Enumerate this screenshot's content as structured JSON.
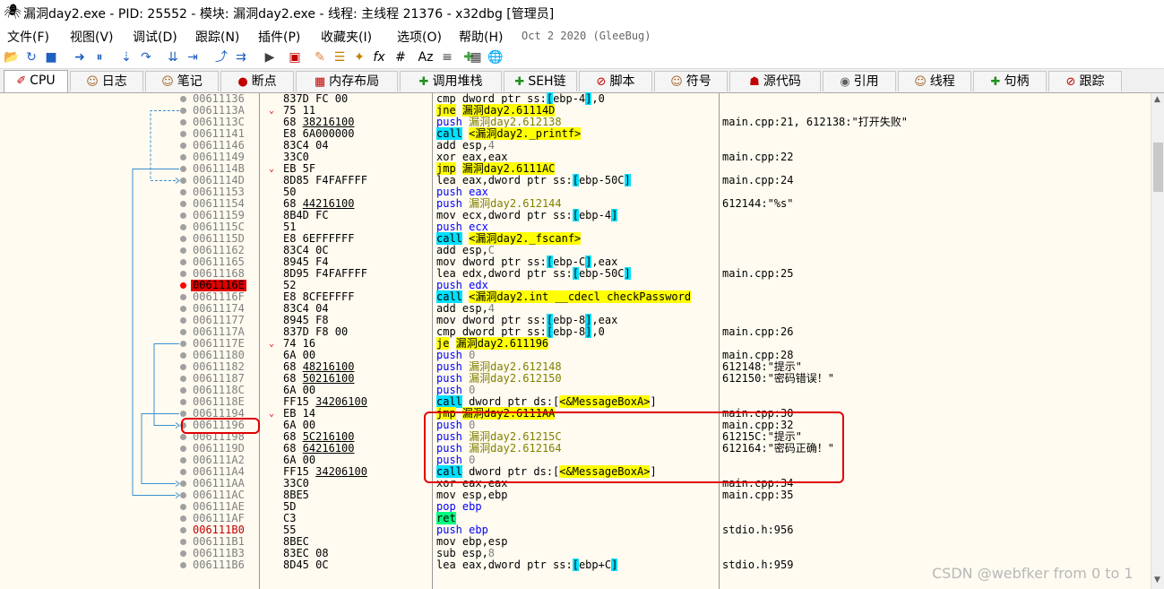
{
  "window": {
    "title": "漏洞day2.exe - PID: 25552 - 模块: 漏洞day2.exe - 线程: 主线程 21376 - x32dbg [管理员]"
  },
  "menu": {
    "items": [
      "文件(F)",
      "视图(V)",
      "调试(D)",
      "跟踪(N)",
      "插件(P)",
      "收藏夹(I)",
      "选项(O)",
      "帮助(H)"
    ],
    "build_date": "Oct 2 2020 (GleeBug)"
  },
  "toolbar": {
    "icons": [
      "open-icon",
      "restart-icon",
      "stop-icon",
      "run-icon",
      "pause-icon",
      "step-into-icon",
      "step-over-icon",
      "trace-into-icon",
      "trace-over-icon",
      "execute-till-return-icon",
      "run-to-user-code-icon",
      "animate-icon",
      "script-icon",
      "comment-icon",
      "label-icon",
      "bookmark-icon",
      "function-icon",
      "hash-icon",
      "font-icon",
      "strings-icon",
      "patch-icon",
      "calculator-icon",
      "help-icon"
    ],
    "fx_label": "fx",
    "hash_label": "#",
    "font_label": "Az"
  },
  "tabs": [
    {
      "label": "CPU",
      "icon": "cpu-icon"
    },
    {
      "label": "日志",
      "icon": "log-icon"
    },
    {
      "label": "笔记",
      "icon": "notes-icon"
    },
    {
      "label": "断点",
      "icon": "breakpoint-icon"
    },
    {
      "label": "内存布局",
      "icon": "memory-icon"
    },
    {
      "label": "调用堆栈",
      "icon": "callstack-icon"
    },
    {
      "label": "SEH链",
      "icon": "seh-icon"
    },
    {
      "label": "脚本",
      "icon": "script-icon"
    },
    {
      "label": "符号",
      "icon": "symbols-icon"
    },
    {
      "label": "源代码",
      "icon": "source-icon"
    },
    {
      "label": "引用",
      "icon": "references-icon"
    },
    {
      "label": "线程",
      "icon": "threads-icon"
    },
    {
      "label": "句柄",
      "icon": "handles-icon"
    },
    {
      "label": "跟踪",
      "icon": "trace-icon"
    }
  ],
  "disasm": [
    {
      "addr": "00611136",
      "bytes": "837D FC 00",
      "instr": [
        [
          "cmp dword ptr ss:",
          ""
        ],
        [
          "[",
          "seg"
        ],
        [
          "ebp-4",
          ""
        ],
        [
          "]",
          "seg"
        ],
        [
          ",0",
          ""
        ]
      ],
      "cmt": ""
    },
    {
      "addr": "0061113A",
      "mark": "v",
      "bytes": "75 11",
      "instr": [
        [
          "jne",
          "jmp"
        ],
        [
          " ",
          ""
        ],
        [
          "漏洞day2.61114D",
          "tgt"
        ]
      ],
      "cmt": ""
    },
    {
      "addr": "0061113C",
      "bytes": "68 38216100",
      "ul": "38216100",
      "instr": [
        [
          "push",
          "push"
        ],
        [
          " ",
          ""
        ],
        [
          "漏洞day2.612138",
          "str"
        ]
      ],
      "cmt": "main.cpp:21, 612138:\"打开失败\""
    },
    {
      "addr": "00611141",
      "bytes": "E8 6A000000",
      "instr": [
        [
          "call",
          "call"
        ],
        [
          " ",
          ""
        ],
        [
          "<漏洞day2._printf>",
          "tgt"
        ]
      ],
      "cmt": ""
    },
    {
      "addr": "00611146",
      "bytes": "83C4 04",
      "instr": [
        [
          "add esp,",
          ""
        ],
        [
          "4",
          "num"
        ]
      ],
      "cmt": ""
    },
    {
      "addr": "00611149",
      "bytes": "33C0",
      "instr": [
        [
          "xor eax,eax",
          ""
        ]
      ],
      "cmt": "main.cpp:22"
    },
    {
      "addr": "0061114B",
      "mark": "v",
      "bytes": "EB 5F",
      "instr": [
        [
          "jmp",
          "jmp"
        ],
        [
          " ",
          ""
        ],
        [
          "漏洞day2.6111AC",
          "tgt"
        ]
      ],
      "cmt": ""
    },
    {
      "addr": "0061114D",
      "bytes": "8D85 F4FAFFFF",
      "instr": [
        [
          "lea eax,dword ptr ss:",
          ""
        ],
        [
          "[",
          "seg"
        ],
        [
          "ebp-50C",
          ""
        ],
        [
          "]",
          "seg"
        ]
      ],
      "cmt": "main.cpp:24"
    },
    {
      "addr": "00611153",
      "bytes": "50",
      "instr": [
        [
          "push eax",
          "push"
        ]
      ],
      "cmt": ""
    },
    {
      "addr": "00611154",
      "bytes": "68 44216100",
      "ul": "44216100",
      "instr": [
        [
          "push",
          "push"
        ],
        [
          " ",
          ""
        ],
        [
          "漏洞day2.612144",
          "str"
        ]
      ],
      "cmt": "612144:\"%s\""
    },
    {
      "addr": "00611159",
      "bytes": "8B4D FC",
      "instr": [
        [
          "mov ecx,dword ptr ss:",
          ""
        ],
        [
          "[",
          "seg"
        ],
        [
          "ebp-4",
          ""
        ],
        [
          "]",
          "seg"
        ]
      ],
      "cmt": ""
    },
    {
      "addr": "0061115C",
      "bytes": "51",
      "instr": [
        [
          "push ecx",
          "push"
        ]
      ],
      "cmt": ""
    },
    {
      "addr": "0061115D",
      "bytes": "E8 6EFFFFFF",
      "instr": [
        [
          "call",
          "call"
        ],
        [
          " ",
          ""
        ],
        [
          "<漏洞day2._fscanf>",
          "tgt"
        ]
      ],
      "cmt": ""
    },
    {
      "addr": "00611162",
      "bytes": "83C4 0C",
      "instr": [
        [
          "add esp,",
          ""
        ],
        [
          "C",
          "num"
        ]
      ],
      "cmt": ""
    },
    {
      "addr": "00611165",
      "bytes": "8945 F4",
      "instr": [
        [
          "mov dword ptr ss:",
          ""
        ],
        [
          "[",
          "seg"
        ],
        [
          "ebp-C",
          ""
        ],
        [
          "]",
          "seg"
        ],
        [
          ",eax",
          ""
        ]
      ],
      "cmt": ""
    },
    {
      "addr": "00611168",
      "bytes": "8D95 F4FAFFFF",
      "instr": [
        [
          "lea edx,dword ptr ss:",
          ""
        ],
        [
          "[",
          "seg"
        ],
        [
          "ebp-50C",
          ""
        ],
        [
          "]",
          "seg"
        ]
      ],
      "cmt": "main.cpp:25"
    },
    {
      "addr": "0061116E",
      "hl": true,
      "bp": "red",
      "bytes": "52",
      "instr": [
        [
          "push edx",
          "push"
        ]
      ],
      "cmt": ""
    },
    {
      "addr": "0061116F",
      "bytes": "E8 8CFEFFFF",
      "instr": [
        [
          "call",
          "call"
        ],
        [
          " ",
          ""
        ],
        [
          "<漏洞day2.int __cdecl checkPassword",
          "tgt"
        ]
      ],
      "cmt": ""
    },
    {
      "addr": "00611174",
      "bytes": "83C4 04",
      "instr": [
        [
          "add esp,",
          ""
        ],
        [
          "4",
          "num"
        ]
      ],
      "cmt": ""
    },
    {
      "addr": "00611177",
      "bytes": "8945 F8",
      "instr": [
        [
          "mov dword ptr ss:",
          ""
        ],
        [
          "[",
          "seg"
        ],
        [
          "ebp-8",
          ""
        ],
        [
          "]",
          "seg"
        ],
        [
          ",eax",
          ""
        ]
      ],
      "cmt": ""
    },
    {
      "addr": "0061117A",
      "bytes": "837D F8 00",
      "instr": [
        [
          "cmp dword ptr ss:",
          ""
        ],
        [
          "[",
          "seg"
        ],
        [
          "ebp-8",
          ""
        ],
        [
          "]",
          "seg"
        ],
        [
          ",0",
          ""
        ]
      ],
      "cmt": "main.cpp:26"
    },
    {
      "addr": "0061117E",
      "mark": "v",
      "bytes": "74 16",
      "instr": [
        [
          "je",
          "jmp"
        ],
        [
          " ",
          ""
        ],
        [
          "漏洞day2.611196",
          "tgt"
        ]
      ],
      "cmt": ""
    },
    {
      "addr": "00611180",
      "bytes": "6A 00",
      "instr": [
        [
          "push",
          "push"
        ],
        [
          " ",
          ""
        ],
        [
          "0",
          "num"
        ]
      ],
      "cmt": "main.cpp:28"
    },
    {
      "addr": "00611182",
      "bytes": "68 48216100",
      "ul": "48216100",
      "instr": [
        [
          "push",
          "push"
        ],
        [
          " ",
          ""
        ],
        [
          "漏洞day2.612148",
          "str"
        ]
      ],
      "cmt": "612148:\"提示\""
    },
    {
      "addr": "00611187",
      "bytes": "68 50216100",
      "ul": "50216100",
      "instr": [
        [
          "push",
          "push"
        ],
        [
          " ",
          ""
        ],
        [
          "漏洞day2.612150",
          "str"
        ]
      ],
      "cmt": "612150:\"密码错误！\""
    },
    {
      "addr": "0061118C",
      "bytes": "6A 00",
      "instr": [
        [
          "push",
          "push"
        ],
        [
          " ",
          ""
        ],
        [
          "0",
          "num"
        ]
      ],
      "cmt": ""
    },
    {
      "addr": "0061118E",
      "bytes": "FF15 34206100",
      "ul": "34206100",
      "instr": [
        [
          "call",
          "call"
        ],
        [
          " dword ptr ds:[",
          ""
        ],
        [
          "<&MessageBoxA>",
          "tgt"
        ],
        [
          "]",
          ""
        ]
      ],
      "cmt": ""
    },
    {
      "addr": "00611194",
      "mark": "v",
      "bytes": "EB 14",
      "instr": [
        [
          "jmp",
          "jmp"
        ],
        [
          " ",
          ""
        ],
        [
          "漏洞day2.6111AA",
          "tgt"
        ]
      ],
      "cmt": "main.cpp:30"
    },
    {
      "addr": "00611196",
      "bytes": "6A 00",
      "instr": [
        [
          "push",
          "push"
        ],
        [
          " ",
          ""
        ],
        [
          "0",
          "num"
        ]
      ],
      "cmt": "main.cpp:32"
    },
    {
      "addr": "00611198",
      "bytes": "68 5C216100",
      "ul": "5C216100",
      "instr": [
        [
          "push",
          "push"
        ],
        [
          " ",
          ""
        ],
        [
          "漏洞day2.61215C",
          "str"
        ]
      ],
      "cmt": "61215C:\"提示\""
    },
    {
      "addr": "0061119D",
      "bytes": "68 64216100",
      "ul": "64216100",
      "instr": [
        [
          "push",
          "push"
        ],
        [
          " ",
          ""
        ],
        [
          "漏洞day2.612164",
          "str"
        ]
      ],
      "cmt": "612164:\"密码正确！\""
    },
    {
      "addr": "006111A2",
      "bytes": "6A 00",
      "instr": [
        [
          "push",
          "push"
        ],
        [
          " ",
          ""
        ],
        [
          "0",
          "num"
        ]
      ],
      "cmt": ""
    },
    {
      "addr": "006111A4",
      "bytes": "FF15 34206100",
      "ul": "34206100",
      "instr": [
        [
          "call",
          "call"
        ],
        [
          " dword ptr ds:[",
          ""
        ],
        [
          "<&MessageBoxA>",
          "tgt"
        ],
        [
          "]",
          ""
        ]
      ],
      "cmt": ""
    },
    {
      "addr": "006111AA",
      "bytes": "33C0",
      "instr": [
        [
          "xor eax,eax",
          ""
        ]
      ],
      "cmt": "main.cpp:34"
    },
    {
      "addr": "006111AC",
      "bytes": "8BE5",
      "instr": [
        [
          "mov esp,ebp",
          ""
        ]
      ],
      "cmt": "main.cpp:35"
    },
    {
      "addr": "006111AE",
      "bytes": "5D",
      "instr": [
        [
          "pop ebp",
          "pop"
        ]
      ],
      "cmt": ""
    },
    {
      "addr": "006111AF",
      "bytes": "C3",
      "instr": [
        [
          "ret",
          "ret"
        ]
      ],
      "cmt": ""
    },
    {
      "addr": "006111B0",
      "red": true,
      "bytes": "55",
      "instr": [
        [
          "push ebp",
          "push"
        ]
      ],
      "cmt": "stdio.h:956"
    },
    {
      "addr": "006111B1",
      "bytes": "8BEC",
      "instr": [
        [
          "mov ebp,esp",
          ""
        ]
      ],
      "cmt": ""
    },
    {
      "addr": "006111B3",
      "bytes": "83EC 08",
      "instr": [
        [
          "sub esp,",
          ""
        ],
        [
          "8",
          "num"
        ]
      ],
      "cmt": ""
    },
    {
      "addr": "006111B6",
      "bytes": "8D45 0C",
      "instr": [
        [
          "lea eax,dword ptr ss:",
          ""
        ],
        [
          "[",
          "seg"
        ],
        [
          "ebp+C",
          ""
        ],
        [
          "]",
          "seg"
        ]
      ],
      "cmt": "stdio.h:959"
    }
  ],
  "watermark": "CSDN @webfker from 0 to 1"
}
